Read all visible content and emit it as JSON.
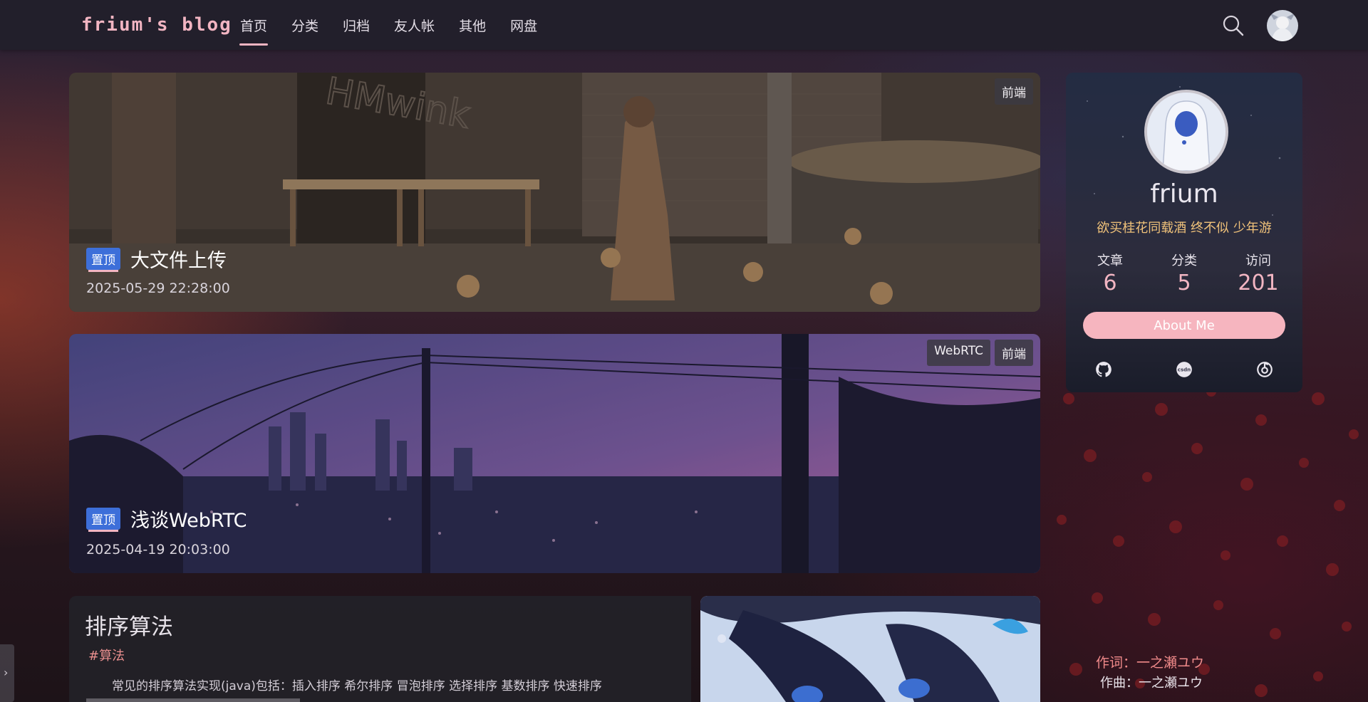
{
  "brand": "frium's blog",
  "nav": [
    "首页",
    "分类",
    "归档",
    "友人帐",
    "其他",
    "网盘"
  ],
  "nav_active": 0,
  "header_icons": [
    "search-icon",
    "user-avatar"
  ],
  "posts": [
    {
      "title": "大文件上传",
      "pin": "置顶",
      "date": "2025-05-29 22:28:00",
      "tags": [
        "前端"
      ],
      "art": "HMwink"
    },
    {
      "title": "浅谈WebRTC",
      "pin": "置顶",
      "date": "2025-04-19 20:03:00",
      "tags": [
        "WebRTC",
        "前端"
      ]
    }
  ],
  "profile": {
    "name": "frium",
    "motto": "欲买桂花同载酒 终不似 少年游",
    "stats": [
      {
        "label": "文章",
        "value": "6"
      },
      {
        "label": "分类",
        "value": "5"
      },
      {
        "label": "访问",
        "value": "201"
      }
    ],
    "about": "About Me",
    "social_icons": [
      "github-icon",
      "csdn-icon",
      "netease-music-icon"
    ]
  },
  "article": {
    "title": "排序算法",
    "tag": "#算法",
    "excerpt": "常见的排序算法实现(java)包括：插入排序 希尔排序 冒泡排序 选择排序 基数排序 快速排序"
  },
  "lyrics": {
    "line1": "作词：一之瀬ユウ",
    "line2": "作曲：一之瀬ユウ"
  },
  "colors": {
    "accent": "#f2b5c2",
    "pin": "#3d6fd9",
    "motto": "#f0c27a",
    "tag": "#ea8f8f"
  }
}
